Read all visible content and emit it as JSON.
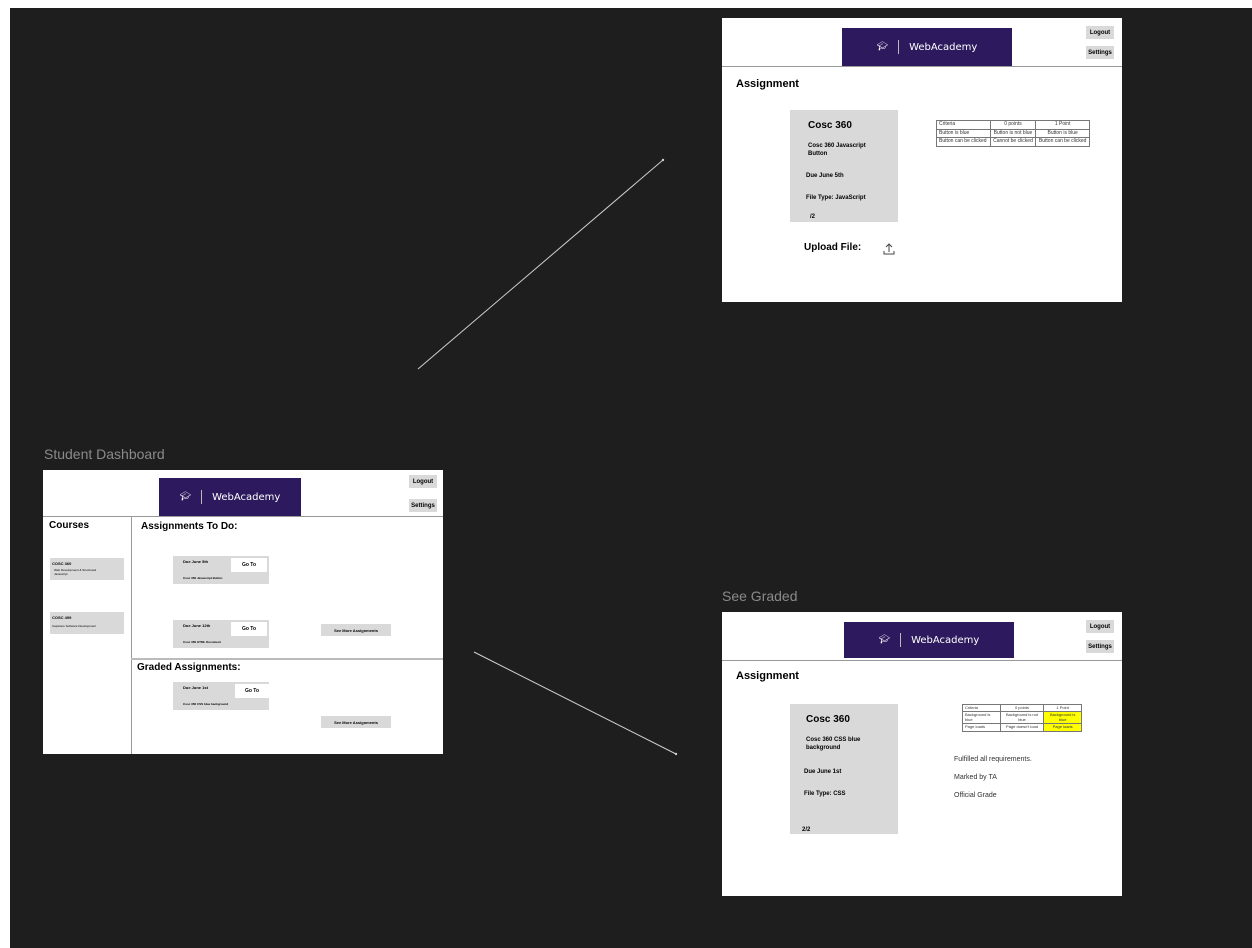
{
  "canvas": {
    "background": "#1e1e1e"
  },
  "frames": {
    "assignment_frame": {
      "banner": {
        "logo_icon": "graduation-cap-icon",
        "brand": "WebAcademy",
        "color": "#2d1a5e"
      },
      "logout_label": "Logout",
      "settings_label": "Settings",
      "title": "Assignment",
      "card": {
        "course": "Cosc 360",
        "name_line1": "Cosc 360 Javascript",
        "name_line2": "Button",
        "due": "Due June 5th",
        "file_type": "File Type: JavaScript",
        "score": "/2"
      },
      "upload_label": "Upload File:",
      "upload_icon": "upload-icon",
      "rubric": {
        "headers": [
          "Criteria",
          "0 points",
          "1 Point"
        ],
        "rows": [
          [
            "Button is blue",
            "Button is not blue",
            "Button is blue"
          ],
          [
            "Button can be clicked",
            "Cannot be clicked",
            "Button can be clicked"
          ]
        ]
      }
    },
    "dashboard_frame": {
      "label": "Student Dashboard",
      "banner": {
        "logo_icon": "graduation-cap-icon",
        "brand": "WebAcademy"
      },
      "logout_label": "Logout",
      "settings_label": "Settings",
      "courses_title": "Courses",
      "courses": [
        {
          "code": "COSC 360",
          "desc_line1": "Web Development & Structured",
          "desc_line2": "Javascript"
        },
        {
          "code": "COSC 499",
          "desc_line1": "Capstone Software Development",
          "desc_line2": ""
        }
      ],
      "todo_title": "Assignments To Do:",
      "todo": [
        {
          "due": "Due June 5th",
          "go": "Go To",
          "name": "Cosc 360 Javascript Button"
        },
        {
          "due": "Due June 12th",
          "go": "Go To",
          "name": "Cosc 360 HTML Document"
        }
      ],
      "see_more_todo": "See More Assignments",
      "graded_title": "Graded Assignments:",
      "graded": [
        {
          "due": "Due June 1st",
          "go": "Go To",
          "name": "Cosc 360 CSS blue background"
        }
      ],
      "see_more_graded": "See More Assignments"
    },
    "graded_frame": {
      "label": "See Graded",
      "banner": {
        "logo_icon": "graduation-cap-icon",
        "brand": "WebAcademy"
      },
      "logout_label": "Logout",
      "settings_label": "Settings",
      "title": "Assignment",
      "card": {
        "course": "Cosc 360",
        "name_line1": "Cosc 360 CSS blue",
        "name_line2": "background",
        "due": "Due June 1st",
        "file_type": "File Type: CSS",
        "score": "2/2"
      },
      "rubric": {
        "headers": [
          "Criteria",
          "0 points",
          "1 Point"
        ],
        "rows": [
          [
            "Background is blue",
            "Background is not blue",
            "Background is blue"
          ],
          [
            "Page loads",
            "Page doesn't load",
            "Page loads"
          ]
        ],
        "highlight_color": "#ffff00"
      },
      "feedback": [
        "Fulfilled all requirements.",
        "Marked by TA",
        "Official Grade"
      ]
    }
  }
}
